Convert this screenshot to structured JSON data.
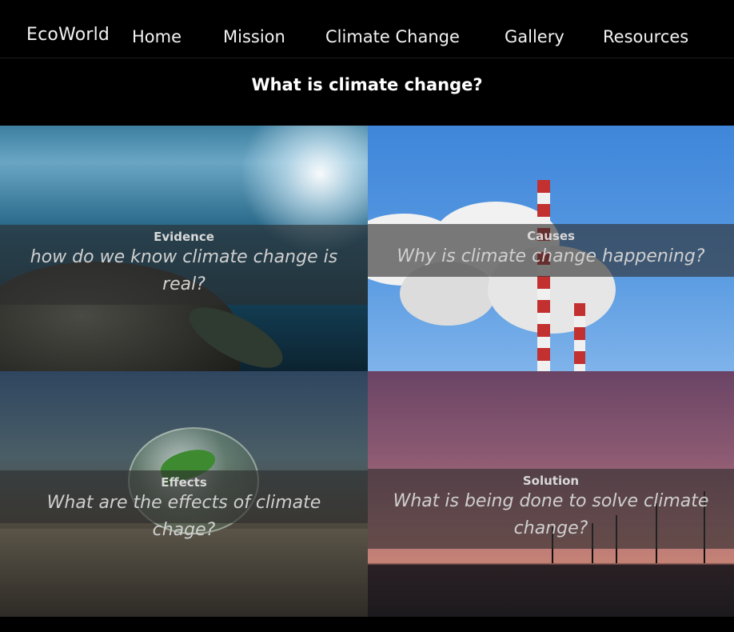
{
  "nav": {
    "brand": "EcoWorld",
    "links": [
      "Home",
      "Mission",
      "Climate Change",
      "Gallery",
      "Resources"
    ]
  },
  "page": {
    "title": "What is climate change?"
  },
  "tiles": [
    {
      "title": "Evidence",
      "question": "how do we know climate change is real?"
    },
    {
      "title": "Causes",
      "question": "Why is climate change happening?"
    },
    {
      "title": "Effects",
      "question": "What are the effects of climate chage?"
    },
    {
      "title": "Solution",
      "question": "What is being done to solve climate change?"
    }
  ],
  "colors": {
    "background": "#000000",
    "text": "#ffffff",
    "band_overlay": "rgba(45,45,45,0.62)"
  }
}
